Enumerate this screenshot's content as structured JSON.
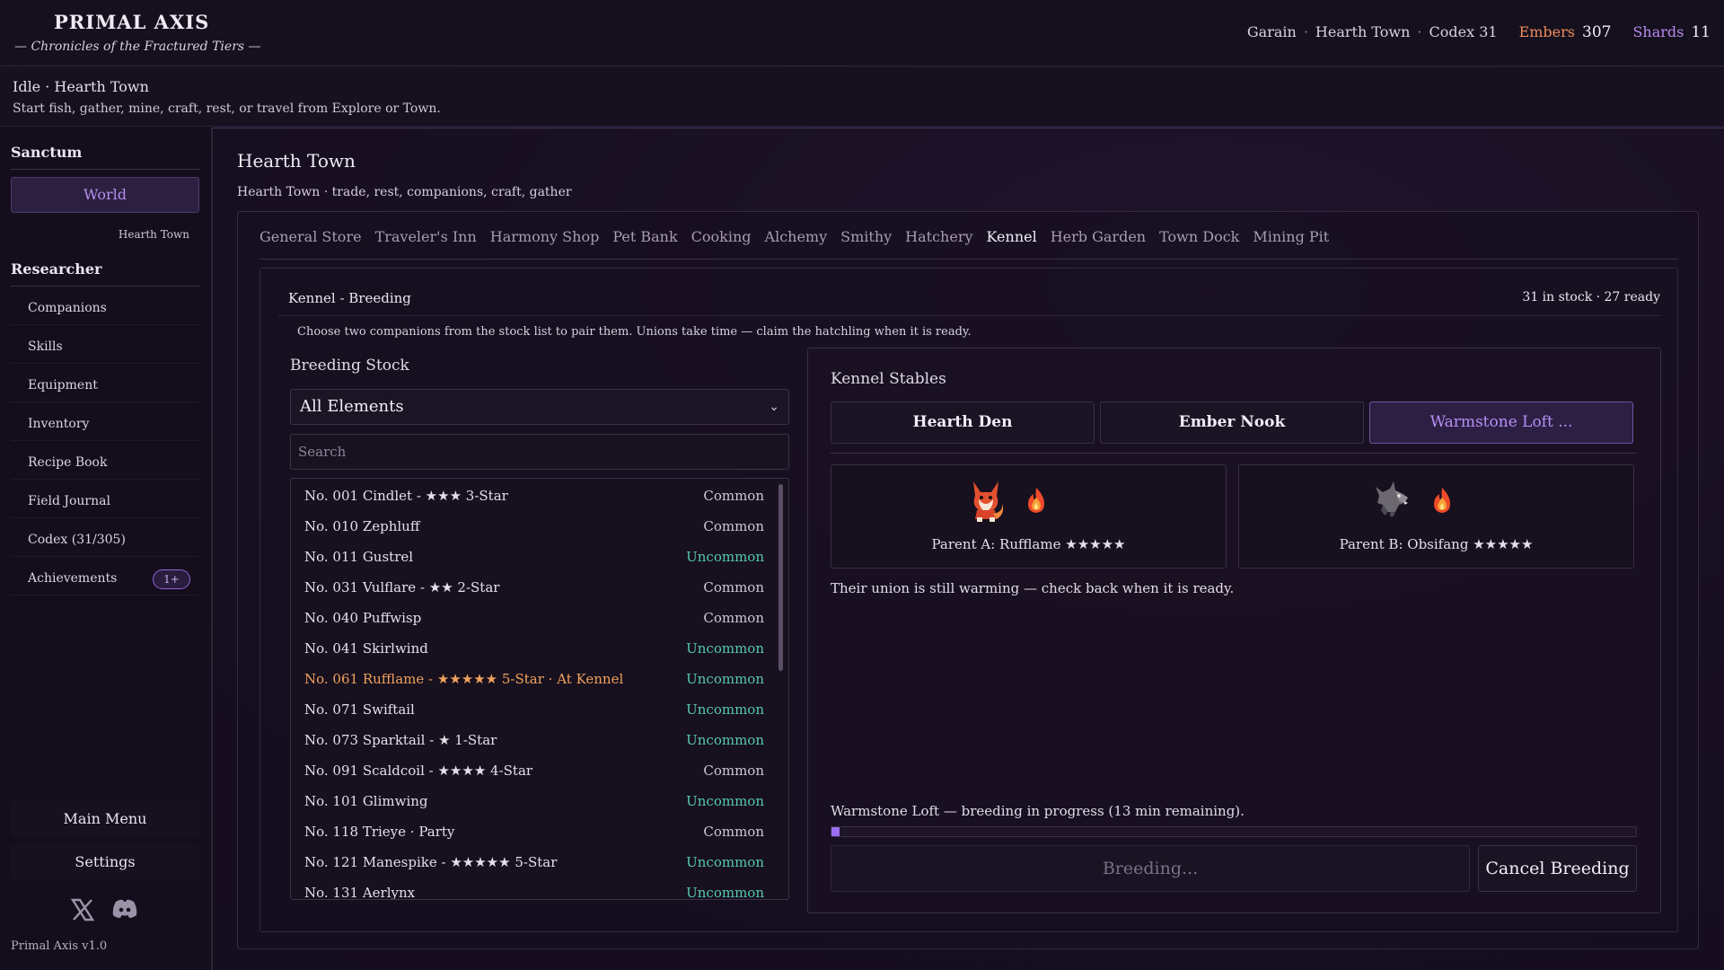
{
  "app": {
    "title": "PRIMAL AXIS",
    "subtitle": "— Chronicles of the Fractured Tiers —",
    "version": "Primal Axis  v1.0"
  },
  "header": {
    "player": "Garain",
    "location": "Hearth Town",
    "codex": "Codex 31",
    "embers_label": "Embers",
    "embers_value": "307",
    "shards_label": "Shards",
    "shards_value": "11",
    "embers_color": "#f08c5a",
    "shards_color": "#b98af0"
  },
  "status": {
    "state": "Idle",
    "location": "Hearth Town",
    "hint": "Start fish, gather, mine, craft, rest, or travel from Explore or Town."
  },
  "sidebar": {
    "sanctum_heading": "Sanctum",
    "world_button": "World",
    "world_sub": "Hearth Town",
    "researcher_heading": "Researcher",
    "items": [
      {
        "label": "Companions",
        "icon": "none"
      },
      {
        "label": "Skills",
        "icon": "none"
      },
      {
        "label": "Equipment",
        "icon": "none"
      },
      {
        "label": "Inventory",
        "icon": "none"
      },
      {
        "label": "Recipe Book",
        "icon": "none"
      },
      {
        "label": "Field Journal",
        "icon": "none"
      },
      {
        "label": "Codex (31/305)",
        "icon": "none"
      },
      {
        "label": "Achievements",
        "icon": "none",
        "badge": "1+"
      }
    ],
    "main_menu": "Main Menu",
    "settings": "Settings",
    "social_icons": [
      "x-icon",
      "discord-icon"
    ]
  },
  "main": {
    "title": "Hearth Town",
    "subtitle": "Hearth Town · trade, rest, companions, craft, gather",
    "tabs": [
      {
        "label": "General Store",
        "active": false
      },
      {
        "label": "Traveler's Inn",
        "active": false
      },
      {
        "label": "Harmony Shop",
        "active": false
      },
      {
        "label": "Pet Bank",
        "active": false
      },
      {
        "label": "Cooking",
        "active": false
      },
      {
        "label": "Alchemy",
        "active": false
      },
      {
        "label": "Smithy",
        "active": false
      },
      {
        "label": "Hatchery",
        "active": false
      },
      {
        "label": "Kennel",
        "active": true
      },
      {
        "label": "Herb Garden",
        "active": false
      },
      {
        "label": "Town Dock",
        "active": false
      },
      {
        "label": "Mining Pit",
        "active": false
      }
    ]
  },
  "kennel": {
    "title": "Kennel - Breeding",
    "stock_summary": "31 in stock · 27 ready",
    "hint": "Choose two companions from the stock list to pair them. Unions take time — claim the hatchling when it is ready.",
    "breeding_stock": {
      "title": "Breeding Stock",
      "element_filter": "All Elements",
      "search_placeholder": "Search",
      "rows": [
        {
          "name": "No. 001 Cindlet - ★★★ 3-Star",
          "rarity": "Common",
          "highlight": false
        },
        {
          "name": "No. 010 Zephluff",
          "rarity": "Common",
          "highlight": false
        },
        {
          "name": "No. 011 Gustrel",
          "rarity": "Uncommon",
          "highlight": false
        },
        {
          "name": "No. 031 Vulflare - ★★ 2-Star",
          "rarity": "Common",
          "highlight": false
        },
        {
          "name": "No. 040 Puffwisp",
          "rarity": "Common",
          "highlight": false
        },
        {
          "name": "No. 041 Skirlwind",
          "rarity": "Uncommon",
          "highlight": false
        },
        {
          "name": "No. 061 Rufflame - ★★★★★ 5-Star · At Kennel",
          "rarity": "Uncommon",
          "highlight": true
        },
        {
          "name": "No. 071 Swiftail",
          "rarity": "Uncommon",
          "highlight": false
        },
        {
          "name": "No. 073 Sparktail - ★ 1-Star",
          "rarity": "Uncommon",
          "highlight": false
        },
        {
          "name": "No. 091 Scaldcoil - ★★★★ 4-Star",
          "rarity": "Common",
          "highlight": false
        },
        {
          "name": "No. 101 Glimwing",
          "rarity": "Uncommon",
          "highlight": false
        },
        {
          "name": "No. 118 Trieye · Party",
          "rarity": "Common",
          "highlight": false
        },
        {
          "name": "No. 121 Manespike - ★★★★★ 5-Star",
          "rarity": "Uncommon",
          "highlight": false
        },
        {
          "name": "No. 131 Aerlynx",
          "rarity": "Uncommon",
          "highlight": false
        }
      ]
    },
    "stables": {
      "title": "Kennel Stables",
      "tabs": [
        {
          "label": "Hearth Den",
          "active": false
        },
        {
          "label": "Ember Nook",
          "active": false
        },
        {
          "label": "Warmstone Loft ...",
          "active": true
        }
      ],
      "parent_a": {
        "label": "Parent A: Rufflame ★★★★★",
        "sprite": "fox-pet-icon",
        "element": "fire-icon"
      },
      "parent_b": {
        "label": "Parent B: Obsifang ★★★★★",
        "sprite": "wolf-pet-icon",
        "element": "fire-icon"
      },
      "union_message": "Their union is still warming — check back when it is ready.",
      "progress_message": "Warmstone Loft — breeding in progress (13 min remaining).",
      "progress": 0.01,
      "breeding_button": "Breeding...",
      "cancel_button": "Cancel Breeding"
    }
  }
}
